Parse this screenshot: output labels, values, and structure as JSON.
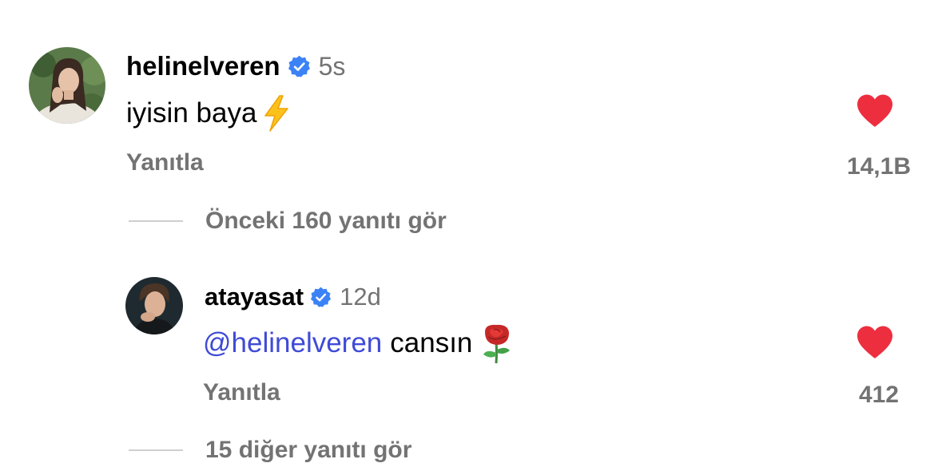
{
  "colors": {
    "text": "#000000",
    "secondary": "#737373",
    "mention": "#3f4bd6",
    "heart": "#ed2e3f",
    "verified": "#3b82f6",
    "thread_line": "#cfcfcf"
  },
  "comment": {
    "username": "helinelveren",
    "verified_icon": "verified-badge-icon",
    "time": "5s",
    "text": "iyisin baya",
    "emoji": "lightning-emoji",
    "reply_label": "Yanıtla",
    "like_icon": "heart-filled-icon",
    "like_count": "14,1B"
  },
  "previous_replies": {
    "label": "Önceki 160 yanıtı gör"
  },
  "reply": {
    "username": "atayasat",
    "verified_icon": "verified-badge-icon",
    "time": "12d",
    "mention": "@helinelveren",
    "text": "cansın",
    "emoji": "rose-emoji",
    "reply_label": "Yanıtla",
    "like_icon": "heart-filled-icon",
    "like_count": "412"
  },
  "more_replies": {
    "label": "15 diğer yanıtı gör"
  }
}
